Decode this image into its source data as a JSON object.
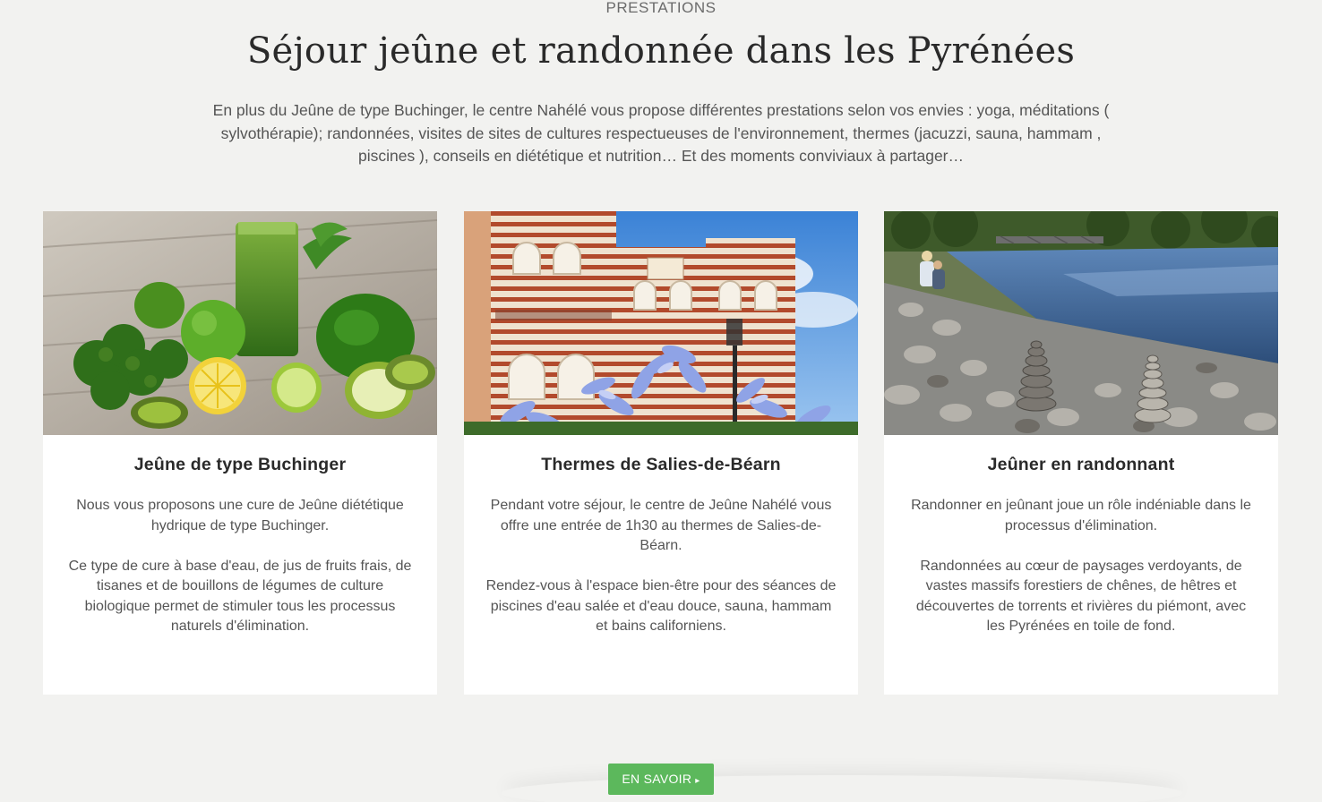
{
  "section": {
    "kicker": "PRESTATIONS",
    "title": "Séjour jeûne et randonnée dans les Pyrénées",
    "intro": "En plus du Jeûne de type Buchinger, le centre Nahélé vous propose différentes prestations selon vos envies : yoga, méditations ( sylvothérapie); randonnées, visites de sites de cultures respectueuses de l'environnement, thermes (jacuzzi, sauna, hammam , piscines ), conseils en diététique et nutrition… Et des moments conviviaux à partager…"
  },
  "cards": [
    {
      "title": "Jeûne de type Buchinger",
      "p1": "Nous vous proposons une cure de Jeûne diététique hydrique de type Buchinger.",
      "p2": "Ce type de cure à base d'eau, de jus de fruits frais, de tisanes et de bouillons de légumes de culture biologique permet de stimuler tous les processus naturels d'élimination.",
      "image": "green-juice-fruits-vegetables-photo"
    },
    {
      "title": "Thermes de Salies-de-Béarn",
      "p1": "Pendant votre séjour, le centre de Jeûne Nahélé vous offre une entrée de 1h30 au thermes de Salies-de-Béarn.",
      "p2": "Rendez-vous à l'espace bien-être pour des séances de piscines d'eau salée et d'eau douce, sauna, hammam et bains californiens.",
      "image": "thermal-building-agapanthus-photo"
    },
    {
      "title": "Jeûner en randonnant",
      "p1": "Randonner en jeûnant joue un rôle indéniable dans le processus d'élimination.",
      "p2": "Randonnées au cœur de paysages verdoyants, de vastes massifs forestiers de chênes, de hêtres et découvertes de torrents et rivières du piémont, avec les Pyrénées en toile de fond.",
      "image": "river-stone-cairns-photo"
    }
  ],
  "cta": {
    "label": "EN SAVOIR",
    "arrow": "▸"
  },
  "colors": {
    "background": "#f2f2f0",
    "button": "#5cb85c",
    "card": "#ffffff"
  }
}
